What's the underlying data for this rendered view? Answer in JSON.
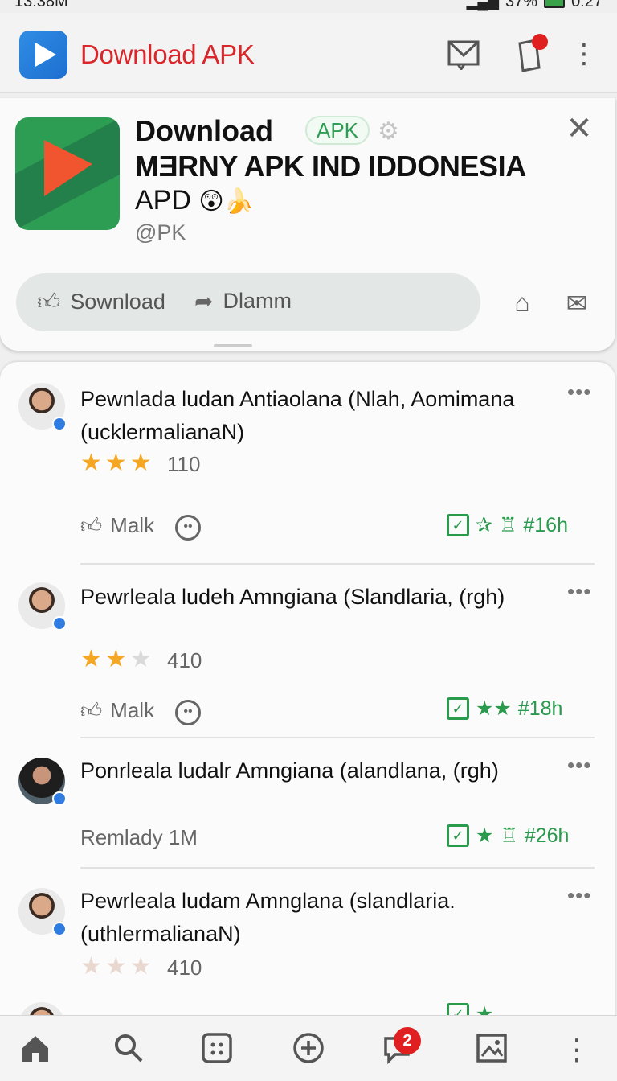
{
  "status": {
    "time": "13:38M",
    "battery": "37%",
    "clock": "0:27"
  },
  "appbar": {
    "title": "Download APK",
    "icons": [
      "mail-icon",
      "tag-icon",
      "more-vert-icon"
    ]
  },
  "header": {
    "title_line1": "Download",
    "chip": "APK",
    "title_line2": "MƎRNY APK IND  IDDONESIA",
    "title_line3": "APD",
    "handle": "@PK",
    "actions": {
      "left_label": "Sownload",
      "right_label": "Dlamm"
    }
  },
  "reviews": [
    {
      "text": "Pewnlada ludan Antiaolana (Nlah, Aomimana (ucklermalianaN)",
      "rating": 3,
      "count": "110",
      "like_label": "Malk",
      "meta": "#16h"
    },
    {
      "text": "Pewrleala ludeh Amngiana (Slandlaria, (rgh)",
      "rating": 2,
      "count": "410",
      "like_label": "Malk",
      "meta": "#18h"
    },
    {
      "text": "Ponrleala ludalr Amngiana (alandlana, (rgh)",
      "secondary": "Remlady  1M",
      "meta": "#26h"
    },
    {
      "text": "Pewrleala ludam Amnglana (slandlaria. (uthlermalianaN)",
      "rating": 0,
      "count": "410"
    }
  ],
  "nav": {
    "badge": "2",
    "items": [
      "home-icon",
      "search-icon",
      "apps-icon",
      "add-icon",
      "chat-icon",
      "gallery-icon",
      "more-vert-icon"
    ]
  },
  "colors": {
    "brand_red": "#d9262a",
    "accent_green": "#2a9a4d",
    "star": "#f5a623"
  }
}
